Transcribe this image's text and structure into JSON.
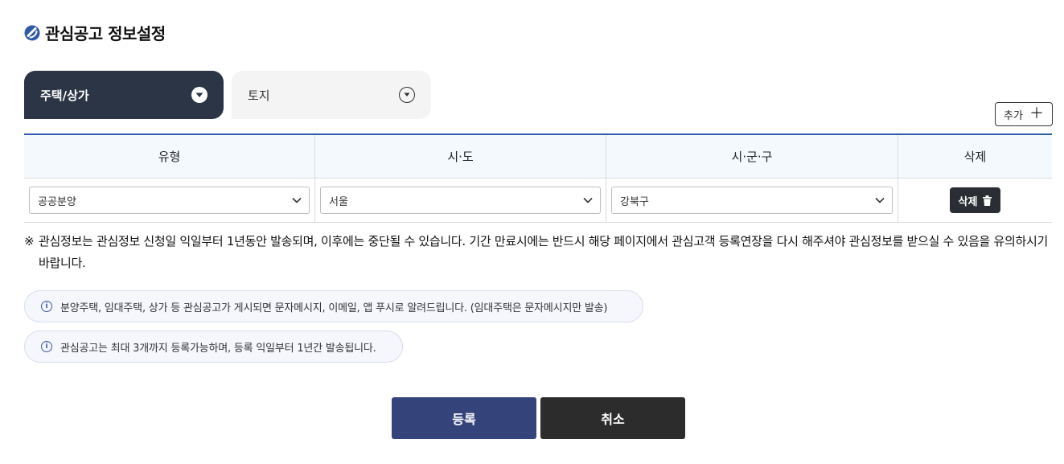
{
  "page": {
    "title": "관심공고 정보설정"
  },
  "tabs": [
    {
      "label": "주택/상가",
      "active": true
    },
    {
      "label": "토지",
      "active": false
    }
  ],
  "toolbar": {
    "add_label": "추가",
    "add_icon": "plus-icon"
  },
  "table": {
    "headers": [
      "유형",
      "시·도",
      "시·군·구",
      "삭제"
    ],
    "rows": [
      {
        "type": "공공분양",
        "sido": "서울",
        "sigungu": "강북구",
        "delete_label": "삭제"
      }
    ]
  },
  "notice": {
    "mark": "※",
    "text": "관심정보는 관심정보 신청일 익일부터 1년동안 발송되며, 이후에는 중단될 수 있습니다. 기간 만료시에는 반드시 해당 페이지에서 관심고객 등록연장을 다시 해주셔야 관심정보를 받으실 수 있음을 유의하시기 바랍니다."
  },
  "info": [
    "분양주택, 임대주택, 상가 등 관심공고가 게시되면 문자메시지, 이메일, 앱 푸시로 알려드립니다. (임대주택은 문자메시지만 발송)",
    "관심공고는 최대 3개까지 등록가능하며, 등록 익일부터 1년간 발송됩니다."
  ],
  "actions": {
    "submit_label": "등록",
    "cancel_label": "취소"
  },
  "colors": {
    "accent": "#2e5aa8",
    "tab_active": "#2b3545",
    "submit": "#34437a",
    "cancel": "#2c2c2c"
  }
}
